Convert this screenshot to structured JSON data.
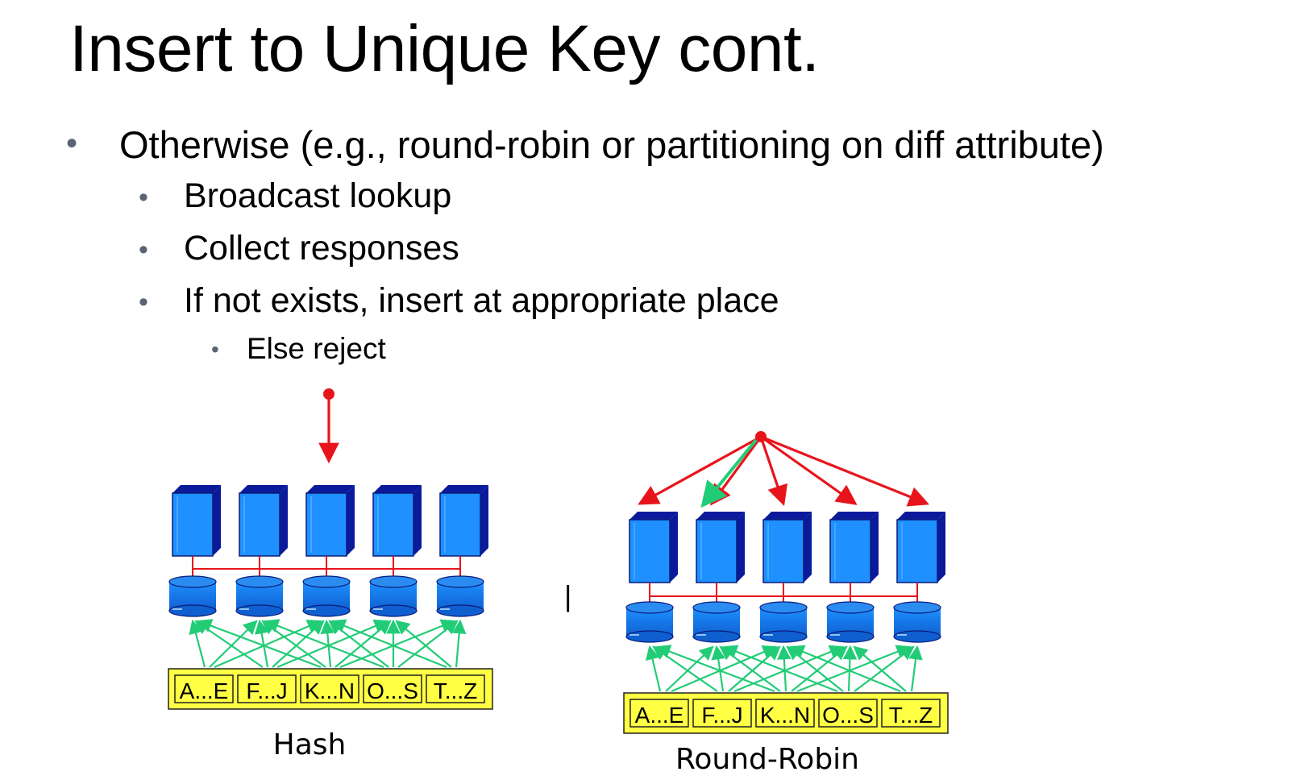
{
  "slide": {
    "title": "Insert to Unique Key cont.",
    "bullets": [
      {
        "level": 1,
        "text": "Otherwise (e.g., round-robin or partitioning on diff attribute)"
      },
      {
        "level": 2,
        "text": "Broadcast lookup"
      },
      {
        "level": 2,
        "text": "Collect responses"
      },
      {
        "level": 2,
        "text": "If not exists, insert at appropriate place"
      },
      {
        "level": 3,
        "text": "Else reject"
      }
    ]
  },
  "diagrams": {
    "hash": {
      "caption": "Hash",
      "ranges": [
        "A...E",
        "F...J",
        "K...N",
        "O...S",
        "T...Z"
      ]
    },
    "round_robin": {
      "caption": "Round-Robin",
      "ranges": [
        "A...E",
        "F...J",
        "K...N",
        "O...S",
        "T...Z"
      ]
    },
    "separator_mark": "|"
  },
  "colors": {
    "server_front": "#1e90ff",
    "server_side": "#0a1a9a",
    "disk": "#1e90ff",
    "request_arrow": "#e8141c",
    "data_arrow": "#22cc77",
    "range_box": "#ffff44"
  }
}
